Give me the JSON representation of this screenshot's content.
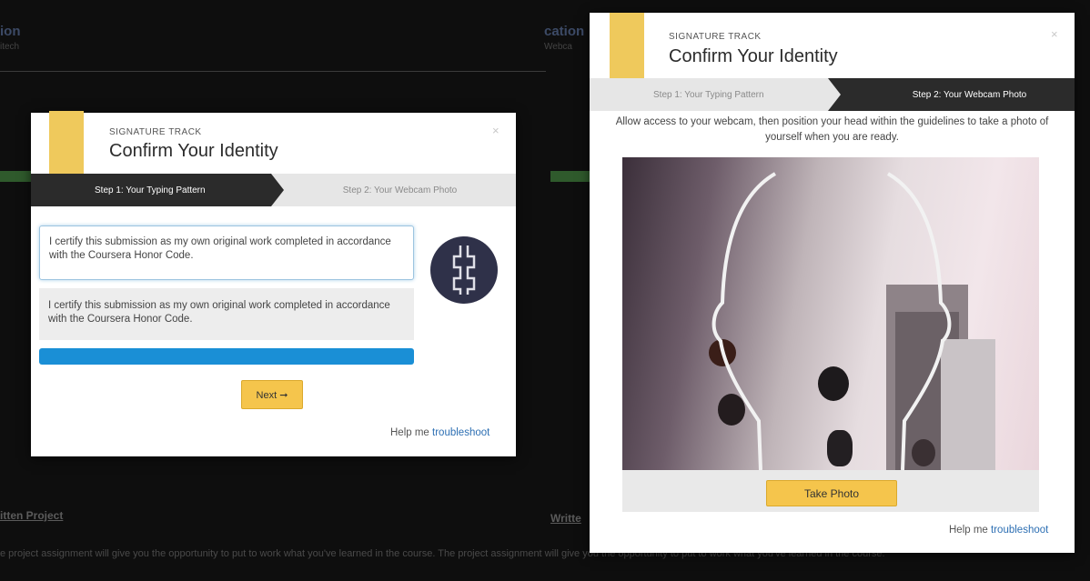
{
  "background": {
    "left_title": "ion",
    "left_subtitle": "itech",
    "right_title": "cation",
    "right_subtitle": "Webca",
    "left_section_heading": "itten Project",
    "right_section_heading": "Writte",
    "footer_line": "e project assignment will give you the opportunity to put to work what you've learned in the course. The project assignment will give you the opportunity to put to work what you've learned in the course."
  },
  "left_modal": {
    "kicker": "SIGNATURE TRACK",
    "title": "Confirm Your Identity",
    "close": "×",
    "step1_label": "Step 1: Your Typing Pattern",
    "step2_label": "Step 2: Your Webcam Photo",
    "typed_text": "I certify this submission as my own original work completed in accordance with the Coursera Honor Code.",
    "reference_text": "I certify this submission as my own original work completed in accordance with the Coursera Honor Code.",
    "progress": 1.0,
    "next_label": "Next ➞",
    "help_prefix": "Help me ",
    "help_link": "troubleshoot",
    "icon": "keystroke-pattern-icon"
  },
  "right_modal": {
    "kicker": "SIGNATURE TRACK",
    "title": "Confirm Your Identity",
    "close": "×",
    "step1_label": "Step 1: Your Typing Pattern",
    "step2_label": "Step 2: Your Webcam Photo",
    "instructions": "Allow access to your webcam, then position your head within the guidelines to take a photo of yourself when you are ready.",
    "take_photo_label": "Take Photo",
    "help_prefix": "Help me ",
    "help_link": "troubleshoot"
  },
  "colors": {
    "ribbon": "#efc95c",
    "active_step": "#2b2b2b",
    "progress": "#1a8fd6",
    "button": "#f5c54c",
    "link": "#2d6fb3"
  }
}
